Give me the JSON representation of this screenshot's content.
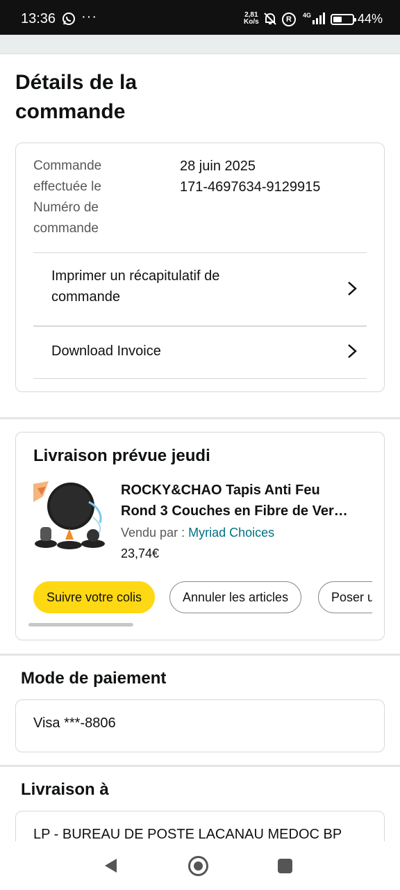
{
  "status_bar": {
    "time": "13:36",
    "more": "···",
    "net_speed_value": "2,81",
    "net_speed_unit": "Ko/s",
    "r_badge": "R",
    "network": "4G",
    "battery_level": 0.44,
    "battery_pct": "44%"
  },
  "page": {
    "title": "Détails de la commande"
  },
  "order": {
    "date_label": "Commande effectuée le",
    "date_value": "28 juin 2025",
    "number_label": "Numéro de commande",
    "number_value": "171-4697634-9129915",
    "print_link": "Imprimer un récapitulatif de commande",
    "invoice_link": "Download Invoice"
  },
  "delivery": {
    "title": "Livraison prévue jeudi",
    "product_title_line1": "ROCKY&CHAO Tapis Anti Feu",
    "product_title_line2": "Rond 3 Couches en Fibre de Ver…",
    "seller_prefix": "Vendu par  : ",
    "seller_name": "Myriad Choices",
    "price": "23,74€",
    "buttons": {
      "track": "Suivre votre colis",
      "cancel": "Annuler les articles",
      "ask": "Poser u"
    }
  },
  "payment": {
    "title": "Mode de paiement",
    "method": "Visa ***-8806"
  },
  "shipping": {
    "title": "Livraison à",
    "address_line1": "LP - BUREAU DE POSTE LACANAU MEDOC BP"
  },
  "colors": {
    "link": "#007185",
    "accent_yellow": "#FFD814",
    "text": "#0F1111",
    "muted": "#565959"
  },
  "icons": [
    "whatsapp-icon",
    "bell-off-icon",
    "signal-icon",
    "battery-icon",
    "chevron-right-icon",
    "back-icon",
    "home-icon",
    "recents-icon"
  ]
}
